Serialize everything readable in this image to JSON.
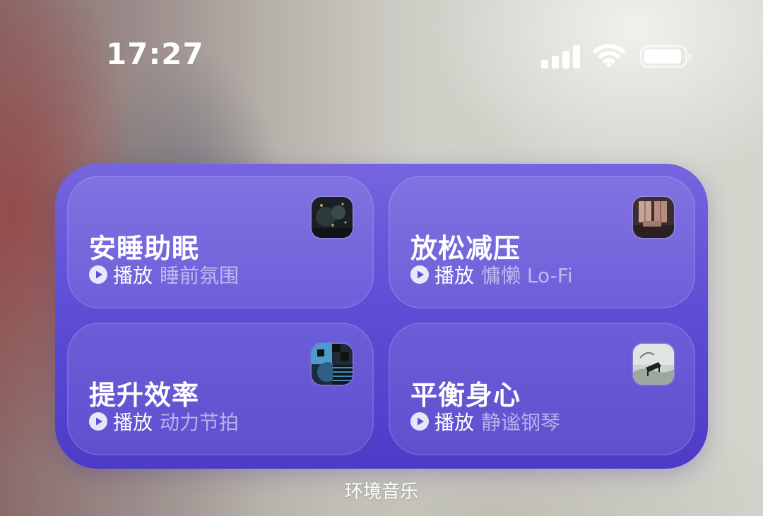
{
  "status_bar": {
    "time": "17:27",
    "icons": [
      "signal-icon",
      "wifi-icon",
      "battery-icon"
    ]
  },
  "widget": {
    "name": "环境音乐",
    "colors": {
      "background_top": "#7565df",
      "background_bottom": "#4b3bc8",
      "card_overlay": "rgba(255,255,255,0.10)"
    },
    "cards": [
      {
        "title": "安睡助眠",
        "play_label": "播放",
        "mood": "睡前氛围",
        "thumbnail": "night-city-artwork"
      },
      {
        "title": "放松减压",
        "play_label": "播放",
        "mood": "慵懒 Lo-Fi",
        "thumbnail": "cozy-room-artwork"
      },
      {
        "title": "提升效率",
        "play_label": "播放",
        "mood": "动力节拍",
        "thumbnail": "geometric-pattern-artwork"
      },
      {
        "title": "平衡身心",
        "play_label": "播放",
        "mood": "静谧钢琴",
        "thumbnail": "piano-landscape-artwork"
      }
    ]
  }
}
